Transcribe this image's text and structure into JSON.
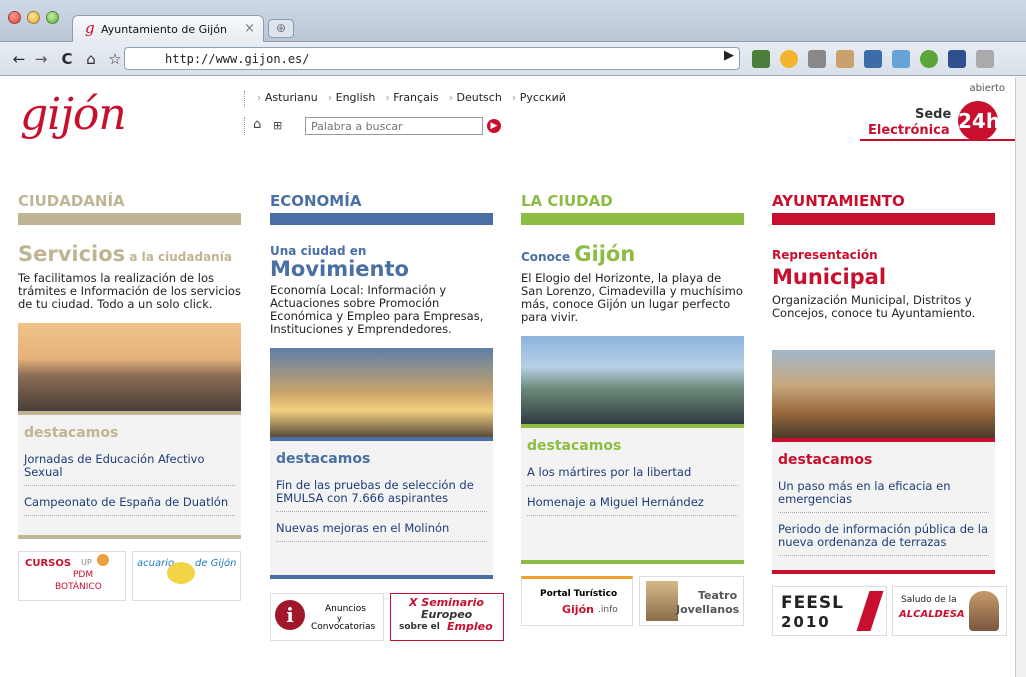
{
  "browser": {
    "tab_title": "Ayuntamiento de Gijón",
    "url": "http://www.gijon.es/"
  },
  "header": {
    "logo_text": "gijón",
    "languages": [
      "Asturianu",
      "English",
      "Français",
      "Deutsch",
      "Русский"
    ],
    "search_placeholder": "Palabra a buscar",
    "sede_abierto": "abierto",
    "sede_title": "Sede",
    "sede_sub": "Electrónica",
    "sede_badge": "24h."
  },
  "columns": [
    {
      "heading": "CIUDADANÍA",
      "color": "#bfb595",
      "hero_big": "Servicios",
      "hero_small": " a la ciudadanía",
      "hero_prefix": "",
      "desc": "Te facilitamos la realización de los trámites e Información de los servicios de tu ciudad. Todo a un solo click.",
      "dest_title": "destacamos",
      "links": [
        "Jornadas de Educación Afectivo Sexual",
        "Campeonato de España de Duatlón"
      ]
    },
    {
      "heading": "ECONOMÍA",
      "color": "#4a6fa5",
      "hero_prefix": "Una ciudad en",
      "hero_big": "Movimiento",
      "hero_small": "",
      "desc": "Economía Local: Información y Actuaciones sobre Promoción Económica y Empleo para Empresas, Instituciones y Emprendedores.",
      "dest_title": "destacamos",
      "links": [
        "Fin de las pruebas de selección de EMULSA con 7.666 aspirantes",
        "Nuevas mejoras en el Molinón"
      ]
    },
    {
      "heading": "LA CIUDAD",
      "color": "#8cbc43",
      "hero_prefix": "",
      "hero_small": "Conoce ",
      "hero_big": "Gijón",
      "desc": "El Elogio del Horizonte, la playa de San Lorenzo, Cimadevilla y muchísimo más, conoce Gijón un lugar perfecto para vivir.",
      "dest_title": "destacamos",
      "links": [
        "A los mártires por la libertad",
        "Homenaje a Miguel Hernández"
      ]
    },
    {
      "heading": "AYUNTAMIENTO",
      "color": "#c8102e",
      "hero_prefix": "",
      "hero_small": "Representación ",
      "hero_big": "Municipal",
      "desc": "Organización Municipal, Distritos y Concejos, conoce tu Ayuntamiento.",
      "dest_title": "destacamos",
      "links": [
        "Un paso más en la eficacia en emergencias",
        "Periodo de información pública de la nueva ordenanza de terrazas"
      ]
    }
  ],
  "banners": {
    "cursos": "CURSOS",
    "up": "UP",
    "pdm": "PDM",
    "botanico": "BOTÁNICO",
    "acuario": "acuario",
    "degijon": "de Gijón",
    "anuncios1": "Anuncios",
    "anuncios2": "y",
    "anuncios3": "Convocatorias",
    "seminario1": "X Seminario",
    "seminario2": "Europeo",
    "seminario3": "sobre el",
    "seminario4": "Empleo",
    "portal1": "Portal Turístico",
    "portal2": "Gijón",
    "portal3": ".info",
    "teatro1": "Teatro",
    "teatro2": "Jovellanos",
    "feesl1": "FEESL",
    "feesl2": "2010",
    "saludo1": "Saludo de la",
    "saludo2": "ALCALDESA"
  }
}
